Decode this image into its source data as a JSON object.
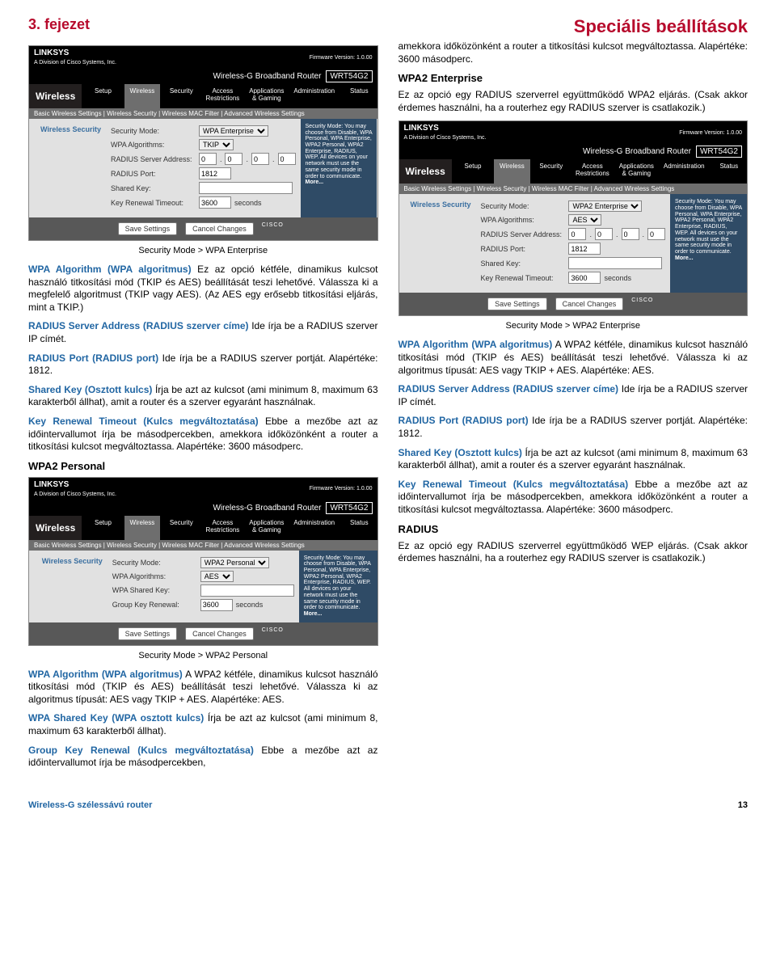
{
  "header": {
    "chapter": "3. fejezet",
    "section": "Speciális beállítások"
  },
  "ui_common": {
    "brand": "LINKSYS",
    "subbrand": "A Division of Cisco Systems, Inc.",
    "fw": "Firmware Version: 1.0.00",
    "product": "Wireless-G Broadband Router",
    "model": "WRT54G2",
    "tabs": [
      "Setup",
      "Wireless",
      "Security",
      "Access\nRestrictions",
      "Applications\n& Gaming",
      "Administration",
      "Status"
    ],
    "side": "Wireless",
    "subtabs": "Basic Wireless Settings   |   Wireless Security   |   Wireless MAC Filter   |   Advanced Wireless Settings",
    "panel_label": "Wireless Security",
    "help_text": "Security Mode: You may choose from Disable, WPA Personal, WPA Enterprise, WPA2 Personal, WPA2 Enterprise, RADIUS, WEP. All devices on your network must use the same security mode in order to communicate.",
    "help_more": "More...",
    "save": "Save Settings",
    "cancel": "Cancel Changes",
    "cisco": "CISCO"
  },
  "ui_wpa_ent": {
    "sec_mode": "WPA Enterprise",
    "fields": {
      "sec_mode_lbl": "Security Mode:",
      "algo_lbl": "WPA Algorithms:",
      "algo_val": "TKIP",
      "radius_addr_lbl": "RADIUS Server\nAddress:",
      "radius_port_lbl": "RADIUS Port:",
      "radius_port_val": "1812",
      "shared_key_lbl": "Shared Key:",
      "renew_lbl": "Key Renewal Timeout:",
      "renew_val": "3600",
      "seconds": "seconds",
      "ip": [
        "0",
        "0",
        "0",
        "0"
      ]
    }
  },
  "ui_wpa2_pers": {
    "sec_mode": "WPA2 Personal",
    "fields": {
      "sec_mode_lbl": "Security Mode:",
      "algo_lbl": "WPA Algorithms:",
      "algo_val": "AES",
      "shared_lbl": "WPA Shared Key:",
      "renew_lbl": "Group Key Renewal:",
      "renew_val": "3600",
      "seconds": "seconds"
    }
  },
  "ui_wpa2_ent": {
    "sec_mode": "WPA2 Enterprise",
    "fields": {
      "sec_mode_lbl": "Security Mode:",
      "algo_lbl": "WPA Algorithms:",
      "algo_val": "AES",
      "radius_addr_lbl": "RADIUS Server\nAddress:",
      "radius_port_lbl": "RADIUS Port:",
      "radius_port_val": "1812",
      "shared_key_lbl": "Shared Key:",
      "renew_lbl": "Key Renewal Timeout:",
      "renew_val": "3600",
      "seconds": "seconds",
      "ip": [
        "0",
        "0",
        "0",
        "0"
      ]
    }
  },
  "text": {
    "p_intro": "amekkora időközönként a router a titkosítási kulcsot megváltoztassa. Alapértéke: 3600 másodperc.",
    "h_wpa2e": "WPA2 Enterprise",
    "p_wpa2e": "Ez az opció egy RADIUS szerverrel együttműködő WPA2 eljárás. (Csak akkor érdemes használni, ha a routerhez egy RADIUS szerver is csatlakozik.)",
    "cap_wpaent": "Security Mode > WPA Enterprise",
    "p_algo_t": "WPA Algorithm (WPA algoritmus)",
    "p_algo": " Ez az opció kétféle, dinamikus kulcsot használó titkosítási mód (TKIP és AES) beállítását teszi lehetővé. Válassza ki a megfelelő algoritmust (TKIP vagy AES). (Az AES egy erősebb titkosítási eljárás, mint a TKIP.)",
    "p_radaddr_t": "RADIUS Server Address (RADIUS szerver címe)",
    "p_radaddr": " Ide írja be a RADIUS szerver IP címét.",
    "p_radport_t": "RADIUS Port (RADIUS port)",
    "p_radport": " Ide írja be a RADIUS szerver portját. Alapértéke: 1812.",
    "p_shared_t": "Shared Key (Osztott kulcs)",
    "p_shared": " Írja be azt az kulcsot (ami minimum 8, maximum 63 karakterből állhat), amit a router és a szerver egyaránt használnak.",
    "p_renew_t": "Key Renewal Timeout (Kulcs megváltoztatása)",
    "p_renew": " Ebbe a mezőbe azt az időintervallumot írja be másodpercekben, amekkora időközönként a router a titkosítási kulcsot megváltoztassa. Alapértéke: 3600 másodperc.",
    "h_wpa2p": "WPA2 Personal",
    "cap_wpa2p": "Security Mode > WPA2 Personal",
    "p_algo2_t": "WPA Algorithm (WPA algoritmus)",
    "p_algo2": " A WPA2 kétféle, dinamikus kulcsot használó titkosítási mód (TKIP és AES) beállítását teszi lehetővé. Válassza ki az algoritmus típusát: AES vagy TKIP + AES. Alapértéke: AES.",
    "p_wpash_t": "WPA Shared Key (WPA osztott kulcs)",
    "p_wpash": " Írja be azt az kulcsot (ami minimum 8, maximum 63 karakterből állhat).",
    "p_gkey_t": "Group Key Renewal (Kulcs megváltoztatása)",
    "p_gkey": " Ebbe a mezőbe azt az időintervallumot írja be másodpercekben,",
    "cap_wpa2e": "Security Mode > WPA2 Enterprise",
    "h_radius": "RADIUS",
    "p_radius": "Ez az opció egy RADIUS szerverrel együttműködő WEP eljárás. (Csak akkor érdemes használni, ha a routerhez egy RADIUS szerver is csatlakozik.)"
  },
  "footer": {
    "product": "Wireless-G szélessávú router",
    "page": "13"
  }
}
